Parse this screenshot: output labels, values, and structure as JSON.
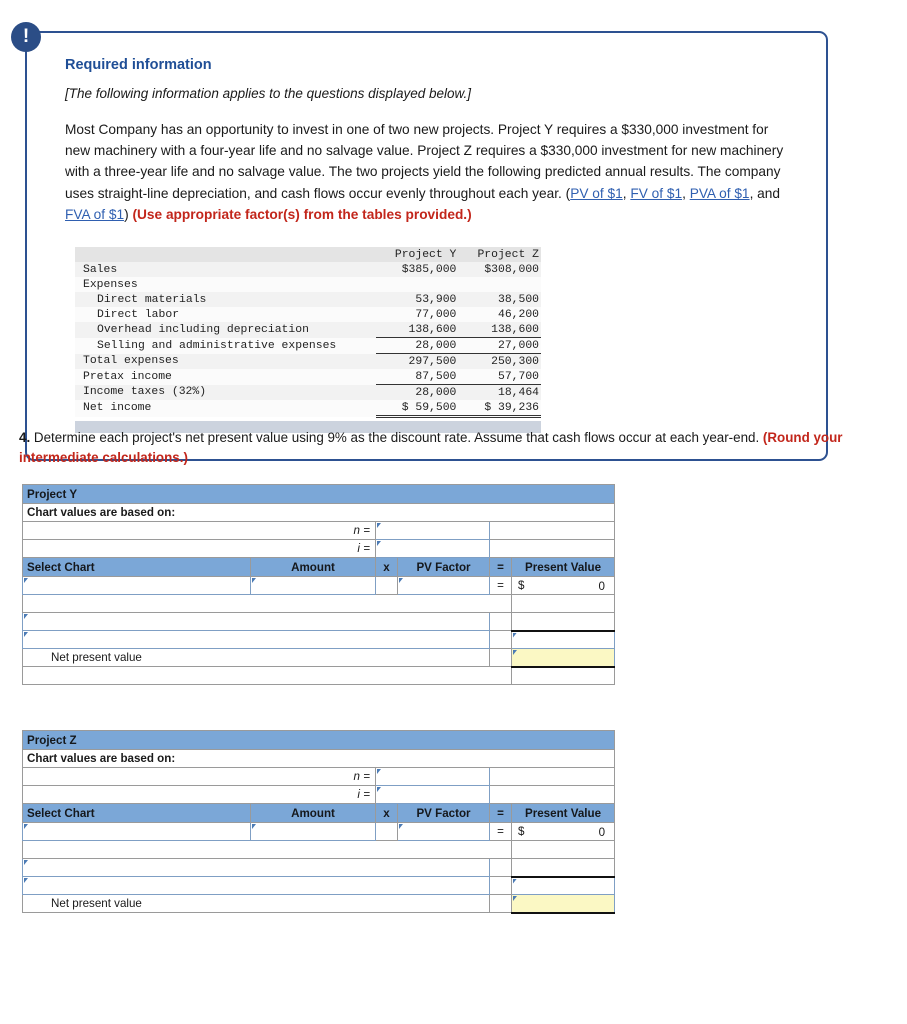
{
  "info_card": {
    "icon": "exclamation-icon",
    "title": "Required information",
    "subtitle": "[The following information applies to the questions displayed below.]",
    "body_part1": "Most Company has an opportunity to invest in one of two new projects. Project Y requires a $330,000 investment for new machinery with a four-year life and no salvage value. Project Z requires a $330,000 investment for new machinery with a three-year life and no salvage value. The two projects yield the following predicted annual results. The company uses straight-line depreciation, and cash flows occur evenly throughout each year. (",
    "link1": "PV of $1",
    "sep1": ", ",
    "link2": "FV of $1",
    "sep2": ", ",
    "link3": "PVA of $1",
    "sep3": ", and ",
    "link4": "FVA of $1",
    "body_part2": ") ",
    "emphasis": "(Use appropriate factor(s) from the tables provided.)"
  },
  "financials": {
    "columns": [
      "Project Y",
      "Project Z"
    ],
    "rows": [
      {
        "label": "Sales",
        "indent": 0,
        "y": "$385,000",
        "z": "$308,000",
        "rule": "none"
      },
      {
        "label": "Expenses",
        "indent": 0,
        "y": "",
        "z": "",
        "rule": "none"
      },
      {
        "label": "Direct materials",
        "indent": 1,
        "y": "53,900",
        "z": "38,500",
        "rule": "none"
      },
      {
        "label": "Direct labor",
        "indent": 1,
        "y": "77,000",
        "z": "46,200",
        "rule": "none"
      },
      {
        "label": "Overhead including depreciation",
        "indent": 1,
        "y": "138,600",
        "z": "138,600",
        "rule": "none"
      },
      {
        "label": "Selling and administrative expenses",
        "indent": 1,
        "y": "28,000",
        "z": "27,000",
        "rule": "bottom"
      },
      {
        "label": "Total expenses",
        "indent": 0,
        "y": "297,500",
        "z": "250,300",
        "rule": "bottom"
      },
      {
        "label": "Pretax income",
        "indent": 0,
        "y": "87,500",
        "z": "57,700",
        "rule": "none"
      },
      {
        "label": "Income taxes (32%)",
        "indent": 0,
        "y": "28,000",
        "z": "18,464",
        "rule": "bottom"
      },
      {
        "label": "Net income",
        "indent": 0,
        "y": "$ 59,500",
        "z": "$ 39,236",
        "rule": "double"
      }
    ]
  },
  "question": {
    "number": "4.",
    "text": " Determine each project's net present value using 9% as the discount rate. Assume that cash flows occur at each year-end. ",
    "emphasis": "(Round your intermediate calculations.)"
  },
  "worksheets": [
    {
      "title": "Project Y",
      "subtitle": "Chart values are based on:",
      "n_label": "n =",
      "n_value": "",
      "i_label": "i =",
      "i_value": "",
      "columns": {
        "select_chart": "Select Chart",
        "amount": "Amount",
        "times": "x",
        "pv_factor": "PV Factor",
        "equals": "=",
        "present_value": "Present Value"
      },
      "entry_row": {
        "chart": "",
        "amount": "",
        "factor": "",
        "eq_sign": "=",
        "dollar": "$",
        "present_value": "0"
      },
      "extra_rows": [
        "",
        ""
      ],
      "net_present_value_label": "Net present value",
      "net_present_value": ""
    },
    {
      "title": "Project Z",
      "subtitle": "Chart values are based on:",
      "n_label": "n =",
      "n_value": "",
      "i_label": "i =",
      "i_value": "",
      "columns": {
        "select_chart": "Select Chart",
        "amount": "Amount",
        "times": "x",
        "pv_factor": "PV Factor",
        "equals": "=",
        "present_value": "Present Value"
      },
      "entry_row": {
        "chart": "",
        "amount": "",
        "factor": "",
        "eq_sign": "=",
        "dollar": "$",
        "present_value": "0"
      },
      "extra_rows": [
        "",
        ""
      ],
      "net_present_value_label": "Net present value",
      "net_present_value": ""
    }
  ],
  "colors": {
    "card_border": "#2d5191",
    "title_blue": "#1f4e96",
    "emphasis_red": "#c2261b",
    "link_blue": "#2f5fb0",
    "header_blue": "#7ba7d7",
    "input_yellow": "#fbf8c4",
    "icon_navy": "#2b4d86"
  }
}
